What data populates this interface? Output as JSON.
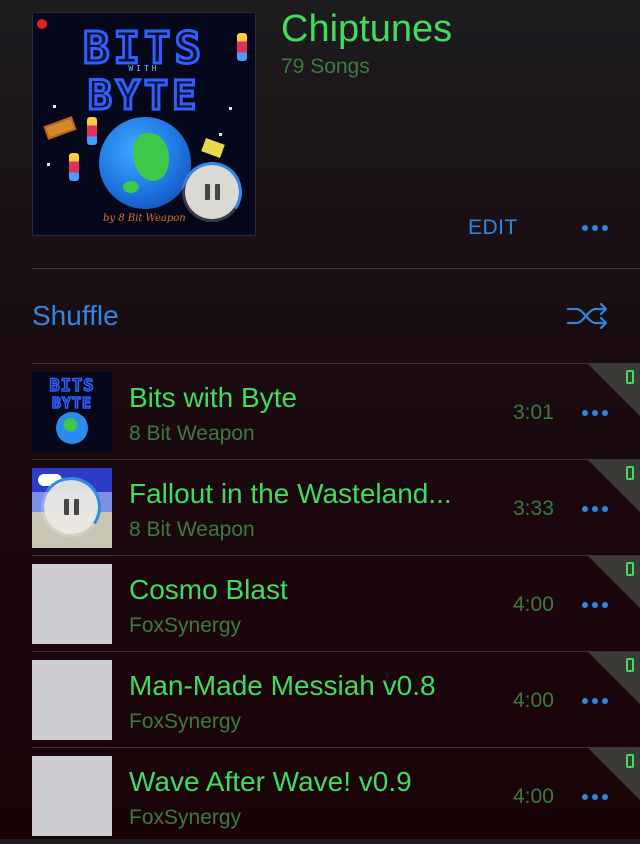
{
  "playlist": {
    "title": "Chiptunes",
    "song_count": "79 Songs",
    "edit_label": "EDIT",
    "more_icon": "ellipsis-icon",
    "artwork_signature": "by 8 Bit Weapon"
  },
  "shuffle": {
    "label": "Shuffle",
    "icon": "shuffle-icon"
  },
  "tracks": [
    {
      "title": "Bits with Byte",
      "artist": "8 Bit Weapon",
      "duration": "3:01",
      "art": "bits-with-byte",
      "downloaded": true
    },
    {
      "title": "Fallout in the Wasteland...",
      "artist": "8 Bit Weapon",
      "duration": "3:33",
      "art": "fallout",
      "downloaded": true,
      "now_playing": true
    },
    {
      "title": "Cosmo Blast",
      "artist": "FoxSynergy",
      "duration": "4:00",
      "art": "placeholder",
      "downloaded": true
    },
    {
      "title": "Man-Made Messiah v0.8",
      "artist": "FoxSynergy",
      "duration": "4:00",
      "art": "placeholder",
      "downloaded": true
    },
    {
      "title": "Wave After Wave! v0.9",
      "artist": "FoxSynergy",
      "duration": "4:00",
      "art": "placeholder",
      "downloaded": true
    }
  ],
  "colors": {
    "accent_blue": "#2d86e0",
    "title_green": "#3fdc5e",
    "subtitle_green": "#3c7a3e",
    "background": "#1a080e"
  }
}
